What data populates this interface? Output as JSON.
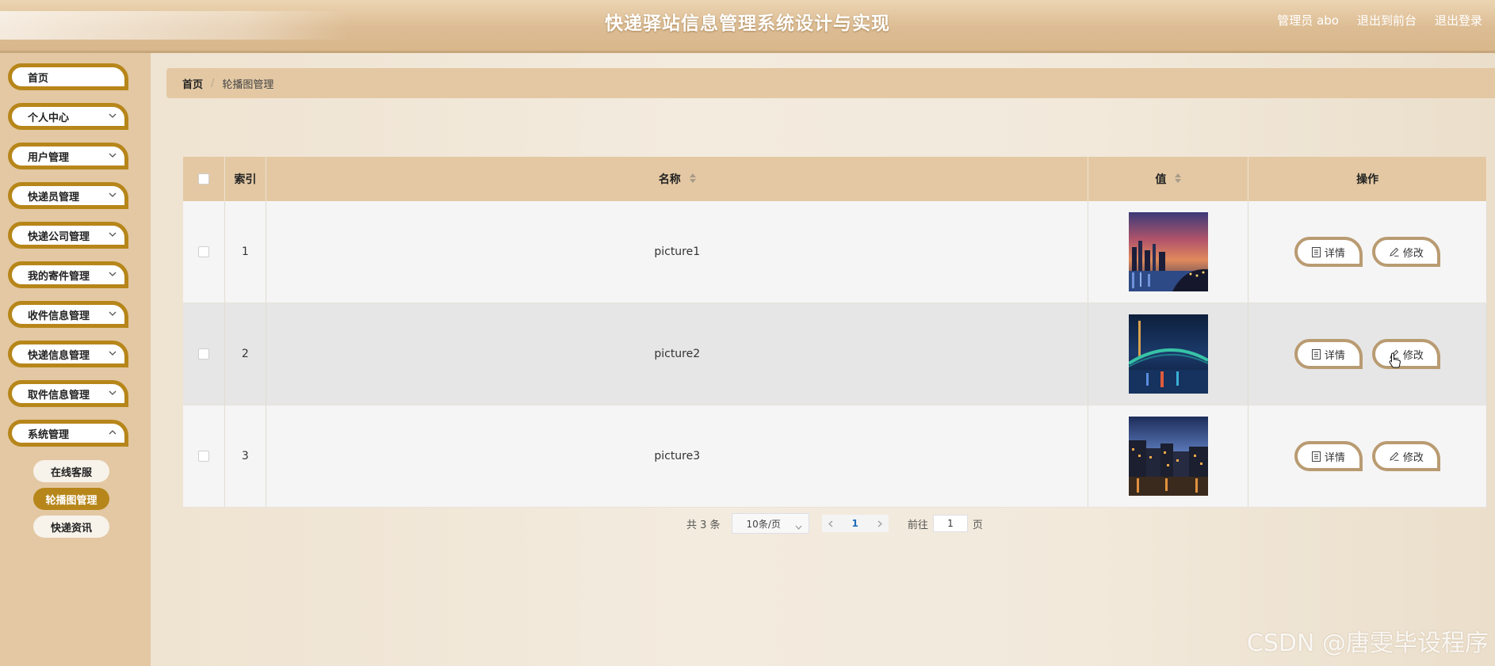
{
  "header": {
    "title": "快递驿站信息管理系统设计与实现",
    "user_label": "管理员 abo",
    "front_link": "退出到前台",
    "logout_link": "退出登录"
  },
  "sidebar": {
    "items": [
      {
        "label": "首页"
      },
      {
        "label": "个人中心"
      },
      {
        "label": "用户管理"
      },
      {
        "label": "快递员管理"
      },
      {
        "label": "快递公司管理"
      },
      {
        "label": "我的寄件管理"
      },
      {
        "label": "收件信息管理"
      },
      {
        "label": "快递信息管理"
      },
      {
        "label": "取件信息管理"
      },
      {
        "label": "系统管理"
      }
    ],
    "submenu": [
      {
        "label": "在线客服"
      },
      {
        "label": "轮播图管理"
      },
      {
        "label": "快递资讯"
      }
    ]
  },
  "breadcrumb": {
    "home": "首页",
    "separator": "/",
    "current": "轮播图管理"
  },
  "table": {
    "headers": {
      "index": "索引",
      "name": "名称",
      "value": "值",
      "operations": "操作"
    },
    "rows": [
      {
        "index": "1",
        "name": "picture1"
      },
      {
        "index": "2",
        "name": "picture2"
      },
      {
        "index": "3",
        "name": "picture3"
      }
    ],
    "detail_label": "详情",
    "edit_label": "修改"
  },
  "pagination": {
    "total": "共 3 条",
    "page_size": "10条/页",
    "current_page": "1",
    "goto_label": "前往",
    "goto_value": "1",
    "page_suffix": "页"
  },
  "watermark": "CSDN @唐雯毕设程序",
  "colors": {
    "accent": "#b7861a",
    "header_bg": "#dcbc93",
    "sidebar_bg": "#e3c8a3",
    "button_border": "#b99b72"
  }
}
